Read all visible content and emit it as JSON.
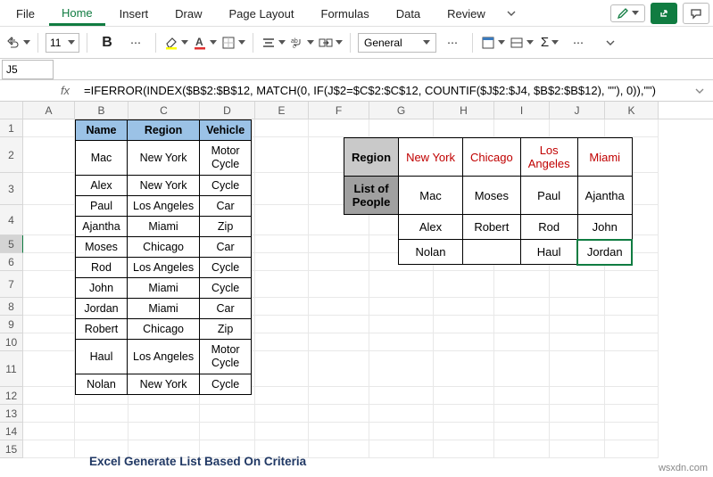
{
  "tabs": {
    "file": "File",
    "home": "Home",
    "insert": "Insert",
    "draw": "Draw",
    "pagelayout": "Page Layout",
    "formulas": "Formulas",
    "data": "Data",
    "review": "Review"
  },
  "toolbar": {
    "fontsize": "11",
    "number_format": "General"
  },
  "namebox": "J5",
  "fx_label": "fx",
  "formula": "=IFERROR(INDEX($B$2:$B$12, MATCH(0, IF(J$2=$C$2:$C$12, COUNTIF($J$2:$J4, $B$2:$B$12), \"\"), 0)),\"\")",
  "columns": [
    "A",
    "B",
    "C",
    "D",
    "E",
    "F",
    "G",
    "H",
    "I",
    "J",
    "K"
  ],
  "rows": [
    "1",
    "2",
    "3",
    "4",
    "5",
    "6",
    "7",
    "8",
    "9",
    "10",
    "11",
    "12",
    "13",
    "14",
    "15"
  ],
  "selected_row": "5",
  "table1": {
    "headers": [
      "Name",
      "Region",
      "Vehicle"
    ],
    "rows": [
      [
        "Mac",
        "New York",
        "Motor Cycle"
      ],
      [
        "Alex",
        "New York",
        "Cycle"
      ],
      [
        "Paul",
        "Los Angeles",
        "Car"
      ],
      [
        "Ajantha",
        "Miami",
        "Zip"
      ],
      [
        "Moses",
        "Chicago",
        "Car"
      ],
      [
        "Rod",
        "Los Angeles",
        "Cycle"
      ],
      [
        "John",
        "Miami",
        "Cycle"
      ],
      [
        "Jordan",
        "Miami",
        "Car"
      ],
      [
        "Robert",
        "Chicago",
        "Zip"
      ],
      [
        "Haul",
        "Los Angeles",
        "Motor Cycle"
      ],
      [
        "Nolan",
        "New York",
        "Cycle"
      ]
    ]
  },
  "table2": {
    "region_label": "Region",
    "list_label": "List of People",
    "cities": [
      "New York",
      "Chicago",
      "Los Angeles",
      "Miami"
    ],
    "body": [
      [
        "Mac",
        "Moses",
        "Paul",
        "Ajantha"
      ],
      [
        "Alex",
        "Robert",
        "Rod",
        "John"
      ],
      [
        "Nolan",
        "",
        "Haul",
        "Jordan"
      ]
    ]
  },
  "caption": "Excel Generate List Based On Criteria",
  "watermark": "wsxdn.com",
  "icons": {
    "chevdown": "▾",
    "sigma": "Σ",
    "pencil": "✎",
    "share": "↗",
    "comment": "⬜"
  }
}
